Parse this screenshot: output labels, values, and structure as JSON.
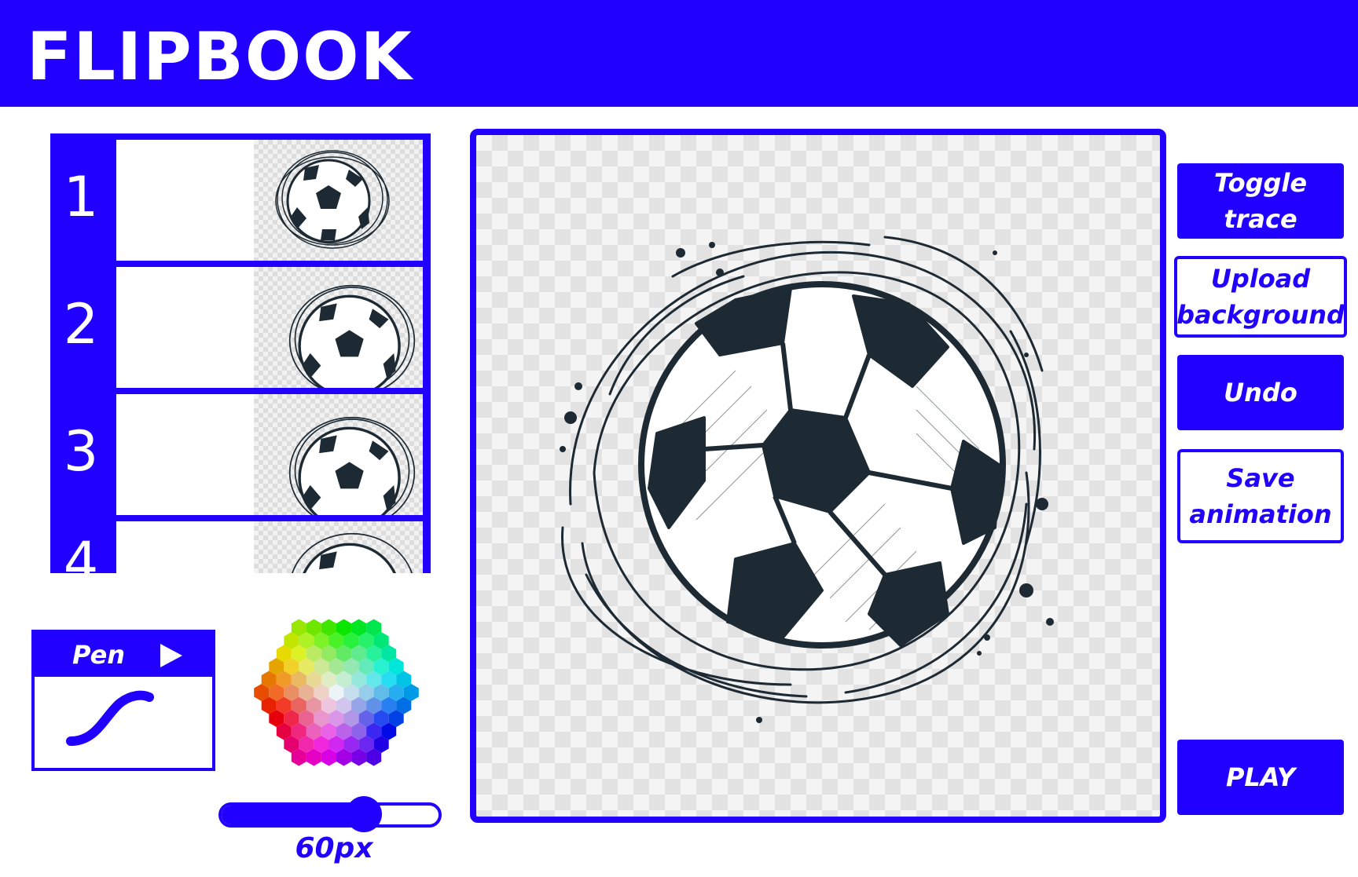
{
  "app": {
    "title": "FLIPBOOK"
  },
  "frames": [
    {
      "number": "1"
    },
    {
      "number": "2"
    },
    {
      "number": "3"
    },
    {
      "number": "4"
    }
  ],
  "tool": {
    "label": "Pen",
    "icon": "play-triangle-icon"
  },
  "brush": {
    "size_label": "60px",
    "size_fraction": 0.65
  },
  "buttons": {
    "toggle_trace": "Toggle trace",
    "upload_background": "Upload background",
    "undo": "Undo",
    "save_animation": "Save animation",
    "play": "PLAY"
  },
  "colors": {
    "accent": "#2200ff",
    "ink": "#1d2a33",
    "white": "#ffffff"
  }
}
